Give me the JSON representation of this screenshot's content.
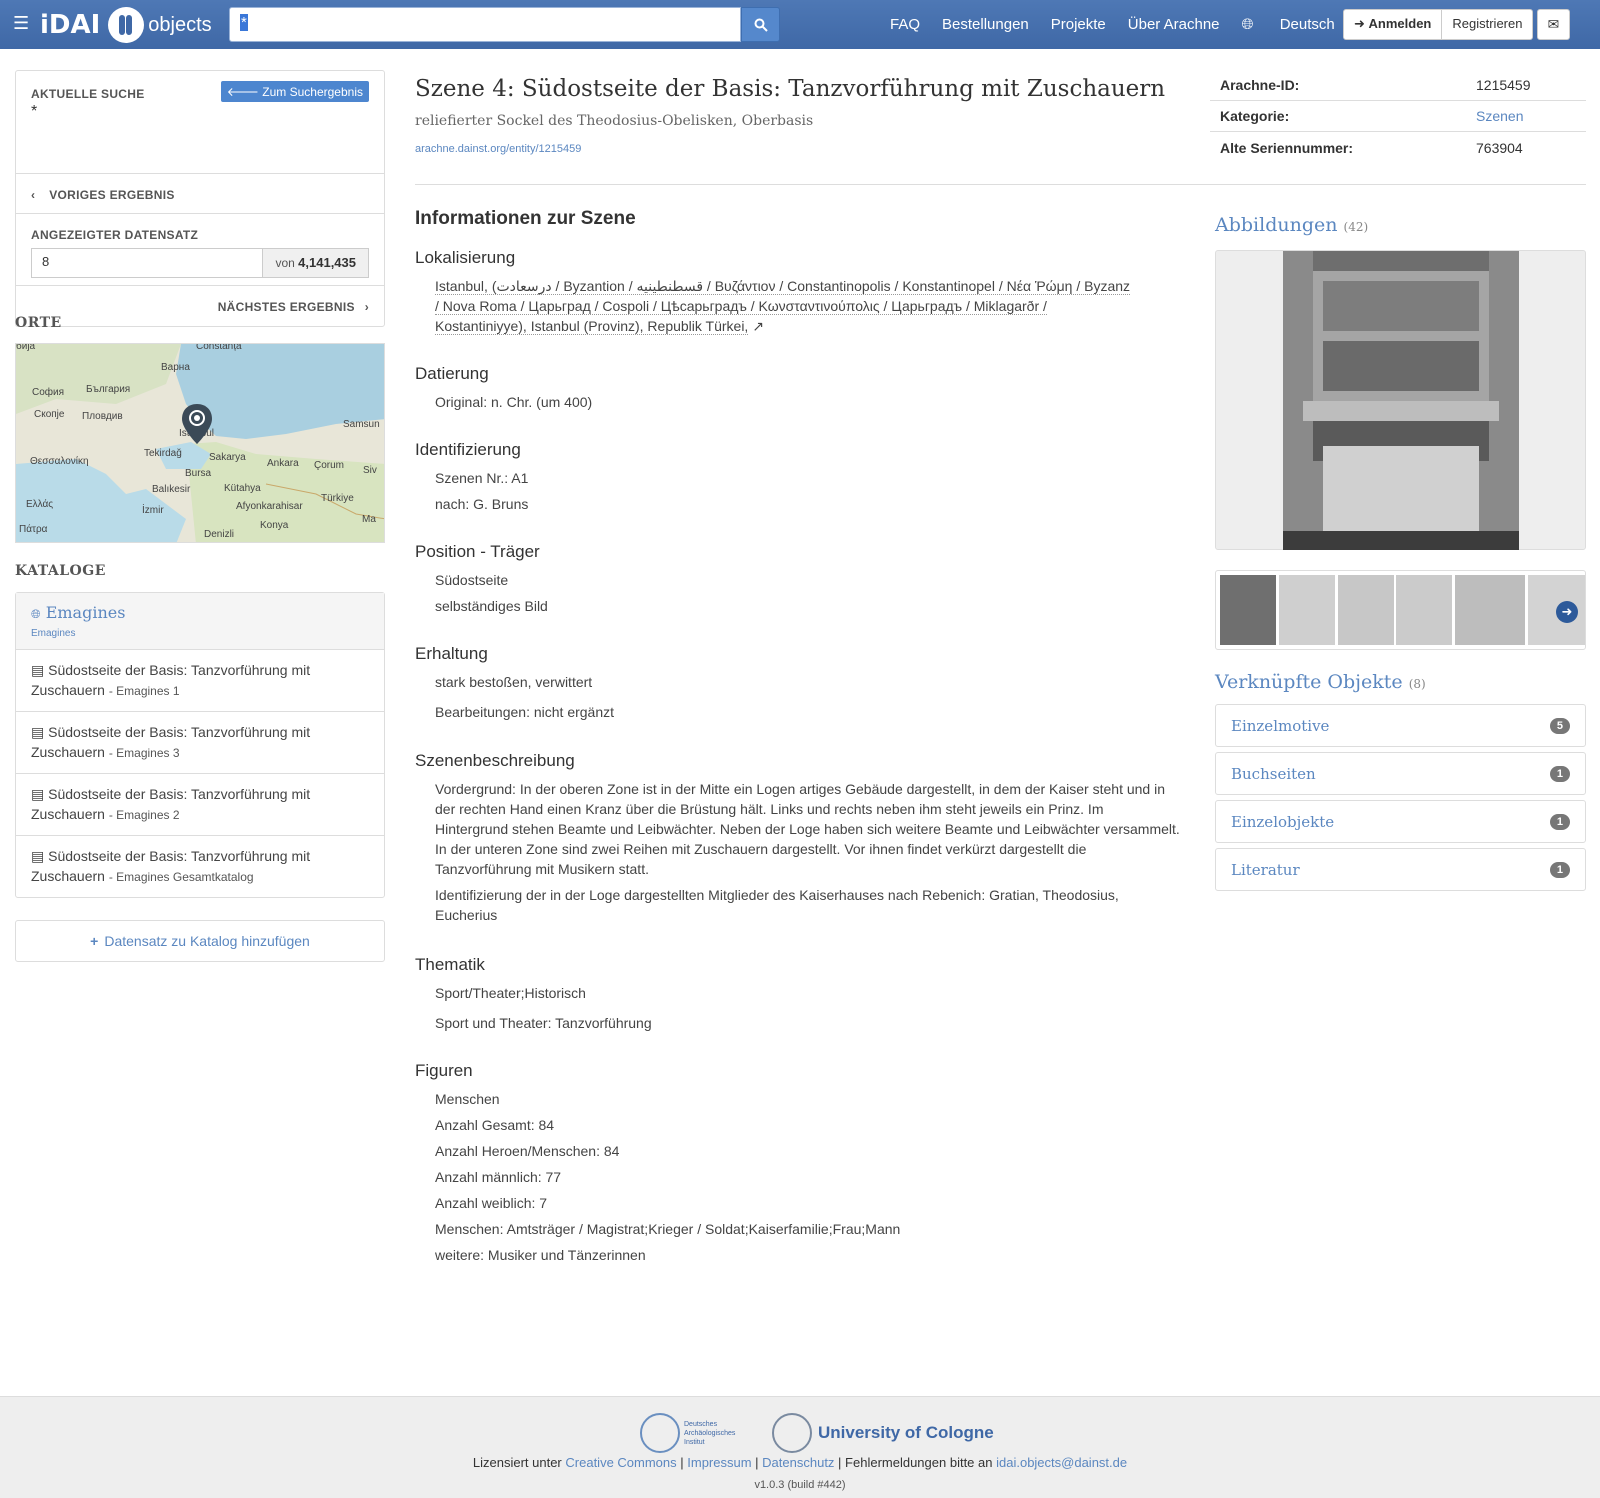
{
  "nav": {
    "brand_idai": "iDAI",
    "brand_objects": "objects",
    "search_value": "*",
    "links": [
      "FAQ",
      "Bestellungen",
      "Projekte",
      "Über Arachne"
    ],
    "language": "Deutsch",
    "login": "Anmelden",
    "register": "Registrieren"
  },
  "search_panel": {
    "current_search_label": "AKTUELLE SUCHE",
    "current_search_value": "*",
    "back_button": "Zum Suchergebnis",
    "previous": "VORIGES ERGEBNIS",
    "record_label": "ANGEZEIGTER DATENSATZ",
    "record_value": "8",
    "record_of": "von",
    "record_total": "4,141,435",
    "next": "NÄCHSTES ERGEBNIS"
  },
  "places": {
    "heading": "ORTE",
    "labels": [
      "Constanța",
      "Варна",
      "България",
      "София",
      "Скопје",
      "Пловдив",
      "Istanbul",
      "Tekirdağ",
      "Θεσσαλονίκη",
      "Sakarya",
      "Samsun",
      "Bursa",
      "Ankara",
      "Çorum",
      "Balıkesir",
      "Kütahya",
      "Ελλάς",
      "İzmir",
      "Afyonkarahisar",
      "Türkiye",
      "Πάτρα",
      "Konya",
      "Denizli",
      "Siv",
      "Ma",
      "бија"
    ]
  },
  "catalogs": {
    "heading": "KATALOGE",
    "group_title": "Emagines",
    "group_sub": "Emagines",
    "items": [
      {
        "title": "Südostseite der Basis: Tanzvorführung mit Zuschauern",
        "catalog": "- Emagines 1"
      },
      {
        "title": "Südostseite der Basis: Tanzvorführung mit Zuschauern",
        "catalog": "- Emagines 3"
      },
      {
        "title": "Südostseite der Basis: Tanzvorführung mit Zuschauern",
        "catalog": "- Emagines 2"
      },
      {
        "title": "Südostseite der Basis: Tanzvorführung mit Zuschauern",
        "catalog": "- Emagines Gesamtkatalog"
      }
    ],
    "add_button": "Datensatz zu Katalog hinzufügen"
  },
  "entity": {
    "title": "Szene 4: Südostseite der Basis: Tanzvorführung mit Zuschauern",
    "subtitle": "reliefierter Sockel des Theodosius-Obelisken, Oberbasis",
    "link": "arachne.dainst.org/entity/1215459",
    "meta": [
      {
        "key": "Arachne-ID:",
        "value": "1215459"
      },
      {
        "key": "Kategorie:",
        "value": "Szenen"
      },
      {
        "key": "Alte Seriennummer:",
        "value": "763904"
      }
    ]
  },
  "info": {
    "heading": "Informationen zur Szene",
    "sections": {
      "lokalisierung": {
        "title": "Lokalisierung",
        "lines": [
          "Istanbul, (درسعادت / Byzantion / قسطنطينيه / Βυζάντιον / Constantinopolis / Konstantinopel / Νέα Ῥώμη / Byzanz",
          "/ Nova Roma / Царьград / Cospoli / Цѣсарьградъ / Κωνσταντινούπολις / Царьградъ / Miklagarðr /",
          "Kostantiniyye), Istanbul (Provinz), Republik Türkei,"
        ]
      },
      "datierung": {
        "title": "Datierung",
        "lines": [
          "Original: n. Chr. (um 400)"
        ]
      },
      "identifizierung": {
        "title": "Identifizierung",
        "lines": [
          "Szenen Nr.: A1",
          "nach: G. Bruns"
        ]
      },
      "position": {
        "title": "Position - Träger",
        "lines": [
          "Südostseite",
          "selbständiges Bild"
        ]
      },
      "erhaltung": {
        "title": "Erhaltung",
        "lines": [
          "stark bestoßen, verwittert",
          "Bearbeitungen: nicht ergänzt"
        ]
      },
      "szenenbeschreibung": {
        "title": "Szenenbeschreibung",
        "lines": [
          "Vordergrund: In der oberen Zone ist in der Mitte ein Logen artiges Gebäude dargestellt, in dem der Kaiser steht und in der rechten Hand einen Kranz über die Brüstung hält. Links und rechts neben ihm steht jeweils ein Prinz. Im Hintergrund stehen Beamte und Leibwächter. Neben der Loge haben sich weitere Beamte und Leibwächter versammelt. In der unteren Zone sind zwei Reihen mit Zuschauern dargestellt. Vor ihnen findet verkürzt dargestellt die Tanzvorführung mit Musikern statt.",
          "Identifizierung der in der Loge dargestellten Mitglieder des Kaiserhauses nach Rebenich: Gratian, Theodosius, Eucherius"
        ]
      },
      "thematik": {
        "title": "Thematik",
        "lines": [
          "Sport/Theater;Historisch",
          "Sport und Theater: Tanzvorführung"
        ]
      },
      "figuren": {
        "title": "Figuren",
        "lines": [
          "Menschen",
          "Anzahl Gesamt: 84",
          "Anzahl Heroen/Menschen: 84",
          "Anzahl männlich: 77",
          "Anzahl weiblich: 7",
          "Menschen: Amtsträger / Magistrat;Krieger / Soldat;Kaiserfamilie;Frau;Mann",
          "weitere: Musiker und Tänzerinnen"
        ]
      }
    }
  },
  "images": {
    "heading": "Abbildungen",
    "count": "(42)"
  },
  "linked_objects": {
    "heading": "Verknüpfte Objekte",
    "count": "(8)",
    "items": [
      {
        "label": "Einzelmotive",
        "count": "5"
      },
      {
        "label": "Buchseiten",
        "count": "1"
      },
      {
        "label": "Einzelobjekte",
        "count": "1"
      },
      {
        "label": "Literatur",
        "count": "1"
      }
    ]
  },
  "footer": {
    "dai_text": "Deutsches Archäologisches Institut",
    "uoc": "University of Cologne",
    "licensed": "Lizensiert unter",
    "cc": "Creative Commons",
    "impressum": "Impressum",
    "datenschutz": "Datenschutz",
    "errors": "Fehlermeldungen bitte an",
    "email": "idai.objects@dainst.de",
    "version": "v1.0.3 (build #442)"
  }
}
